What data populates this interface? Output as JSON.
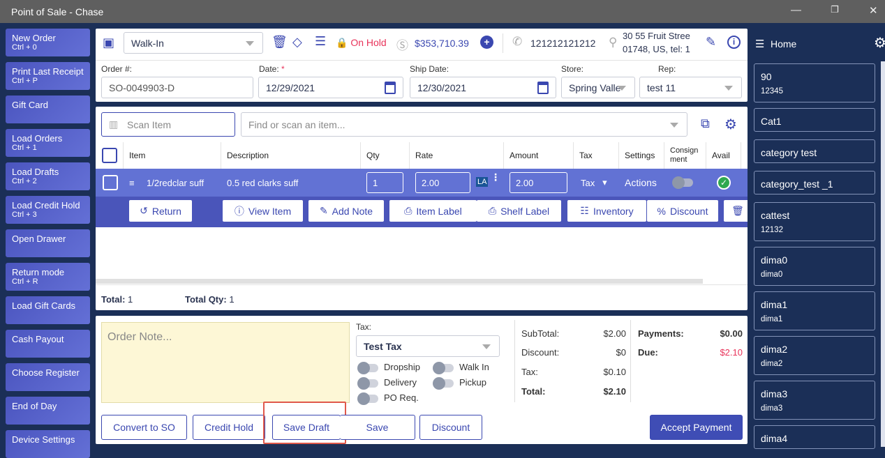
{
  "window": {
    "title": "Point of Sale - Chase"
  },
  "left_buttons": [
    {
      "label": "New Order",
      "shortcut": "Ctrl + 0"
    },
    {
      "label": "Print Last Receipt",
      "shortcut": "Ctrl + P"
    },
    {
      "label": "Gift Card",
      "shortcut": ""
    },
    {
      "label": "Load Orders",
      "shortcut": "Ctrl + 1"
    },
    {
      "label": "Load Drafts",
      "shortcut": "Ctrl + 2"
    },
    {
      "label": "Load Credit Hold",
      "shortcut": "Ctrl + 3"
    },
    {
      "label": "Open Drawer",
      "shortcut": ""
    },
    {
      "label": "Return mode",
      "shortcut": "Ctrl + R"
    },
    {
      "label": "Load Gift Cards",
      "shortcut": ""
    },
    {
      "label": "Cash Payout",
      "shortcut": ""
    },
    {
      "label": "Choose Register",
      "shortcut": ""
    },
    {
      "label": "End of Day",
      "shortcut": ""
    },
    {
      "label": "Device Settings",
      "shortcut": ""
    }
  ],
  "header": {
    "customer": "Walk-In",
    "status": "On Hold",
    "balance": "$353,710.39",
    "phone": "121212121212",
    "address_line1": "30 55 Fruit Stree",
    "address_line2": "01748, US,  tel: 1",
    "order_label": "Order #:",
    "order_value": "SO-0049903-D",
    "date_label": "Date:",
    "required_mark": "*",
    "date_value": "12/29/2021",
    "ship_label": "Ship Date:",
    "ship_value": "12/30/2021",
    "store_label": "Store:",
    "store_value": "Spring Valle",
    "rep_label": "Rep:",
    "rep_value": "test 11"
  },
  "items": {
    "scan_placeholder": "Scan Item",
    "search_placeholder": "Find or scan an item...",
    "columns": {
      "item": "Item",
      "description": "Description",
      "qty": "Qty",
      "rate": "Rate",
      "amount": "Amount",
      "tax": "Tax",
      "settings": "Settings",
      "consignment": "Consign ment",
      "avail": "Avail"
    },
    "row": {
      "item": "1/2redclar suff",
      "description": "0.5 red clarks suff",
      "qty": "1",
      "rate": "2.00",
      "price_level": "LA",
      "amount": "2.00",
      "tax": "Tax",
      "settings": "Actions"
    },
    "actions": [
      "Return",
      "View Item",
      "Add Note",
      "Item Label",
      "Shelf Label",
      "Inventory",
      "Discount"
    ],
    "total_label": "Total:",
    "total_value": "1",
    "total_qty_label": "Total Qty:",
    "total_qty_value": "1"
  },
  "bottom": {
    "note_placeholder": "Order Note...",
    "tax_label": "Tax:",
    "tax_value": "Test Tax",
    "toggles": [
      "Dropship",
      "Walk In",
      "Delivery",
      "Pickup",
      "PO Req."
    ],
    "subtotal_label": "SubTotal:",
    "subtotal": "$2.00",
    "discount_label": "Discount:",
    "discount": "$0",
    "tax_amt_label": "Tax:",
    "tax_amt": "$0.10",
    "total_label": "Total:",
    "total": "$2.10",
    "payments_label": "Payments:",
    "payments": "$0.00",
    "due_label": "Due:",
    "due": "$2.10",
    "buttons": {
      "convert": "Convert to SO",
      "credit_hold": "Credit Hold",
      "save_draft": "Save Draft",
      "save": "Save",
      "discount": "Discount",
      "accept": "Accept Payment"
    }
  },
  "right": {
    "title": "Home",
    "cards": [
      {
        "title": "90",
        "sub": "12345"
      },
      {
        "title": "Cat1",
        "sub": ""
      },
      {
        "title": "category test",
        "sub": ""
      },
      {
        "title": "category_test _1",
        "sub": ""
      },
      {
        "title": "cattest",
        "sub": "12132"
      },
      {
        "title": "dima0",
        "sub": "dima0"
      },
      {
        "title": "dima1",
        "sub": "dima1"
      },
      {
        "title": "dima2",
        "sub": "dima2"
      },
      {
        "title": "dima3",
        "sub": "dima3"
      },
      {
        "title": "dima4",
        "sub": ""
      }
    ]
  },
  "colors": {
    "accent": "#3a47b0",
    "danger": "#e8335a",
    "background": "#1b2f57"
  }
}
